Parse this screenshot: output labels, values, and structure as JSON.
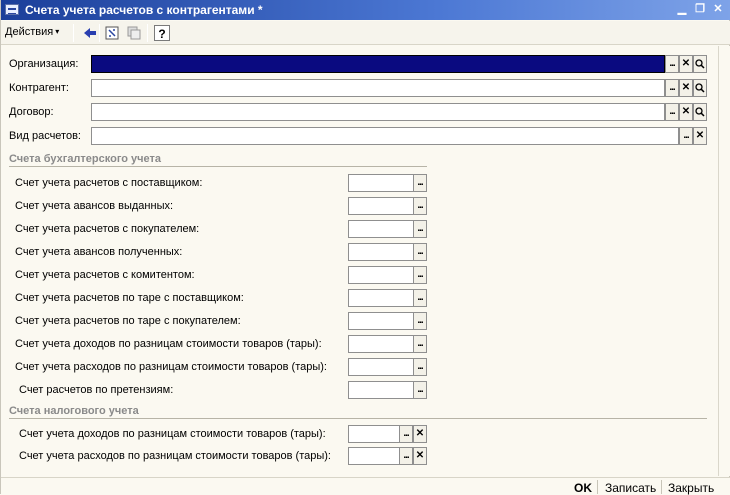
{
  "window": {
    "title": "Счета учета расчетов с контрагентами *",
    "minimize_icon": "minimize-icon",
    "maximize_icon": "restore-icon",
    "close_icon": "close-icon"
  },
  "toolbar": {
    "actions_label": "Действия",
    "actions_arrow": "▾",
    "back_icon": "arrow-left-icon",
    "refresh_icon": "refresh-icon",
    "copy_icon": "copy-icon",
    "help_label": "?"
  },
  "fields": [
    {
      "label": "Организация:",
      "value": ""
    },
    {
      "label": "Контрагент:",
      "value": ""
    },
    {
      "label": "Договор:",
      "value": ""
    },
    {
      "label": "Вид расчетов:",
      "value": ""
    }
  ],
  "buttons": {
    "dots": "...",
    "clear": "✕",
    "search": "🔍"
  },
  "accounting_section": {
    "title": "Счета бухгалтерского учета",
    "rows": [
      "Счет учета расчетов с поставщиком:",
      "Счет учета авансов выданных:",
      "Счет учета расчетов с покупателем:",
      "Счет учета авансов полученных:",
      "Счет учета расчетов с комитентом:",
      "Счет учета расчетов по таре с поставщиком:",
      "Счет учета расчетов по таре с покупателем:",
      "Счет учета доходов по разницам стоимости товаров (тары):",
      "Счет учета расходов по разницам стоимости товаров (тары):",
      "Счет расчетов по претензиям:"
    ]
  },
  "tax_section": {
    "title": "Счета налогового учета",
    "rows": [
      "Счет учета доходов по разницам стоимости товаров (тары):",
      "Счет учета расходов по разницам стоимости товаров (тары):"
    ]
  },
  "bottom": {
    "ok": "OK",
    "save": "Записать",
    "close": "Закрыть"
  }
}
